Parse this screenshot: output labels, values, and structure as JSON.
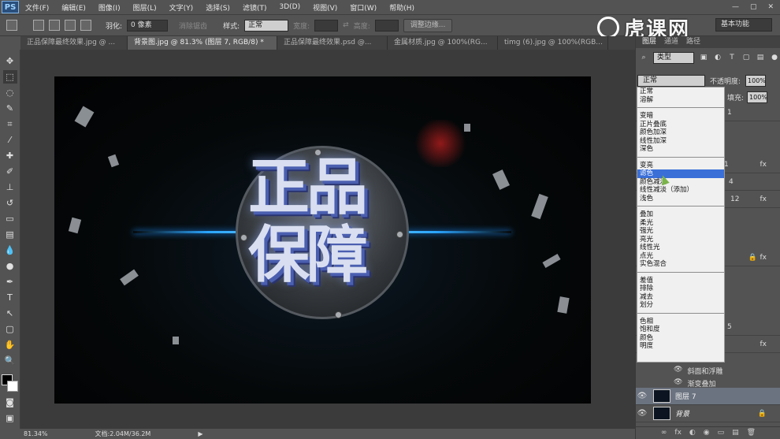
{
  "app": {
    "logo": "PS"
  },
  "menu": [
    "文件(F)",
    "编辑(E)",
    "图像(I)",
    "图层(L)",
    "文字(Y)",
    "选择(S)",
    "滤镜(T)",
    "3D(D)",
    "视图(V)",
    "窗口(W)",
    "帮助(H)"
  ],
  "window_controls": [
    "—",
    "▢",
    "✕"
  ],
  "options": {
    "feather_label": "羽化:",
    "feather_value": "0 像素",
    "antialias_label": "消除锯齿",
    "style_label": "样式:",
    "style_value": "正常",
    "width_label": "宽度:",
    "height_label": "高度:",
    "refine_button": "调整边缘...",
    "workspace": "基本功能"
  },
  "watermark": {
    "text": "虎课网"
  },
  "tabs": [
    "正品保障最终效果.jpg @ ...",
    "背景图.jpg @ 81.3% (图层 7, RGB/8) *",
    "正品保障最终效果.psd @...",
    "金属材质.jpg @ 100%(RG...",
    "timg (6).jpg @ 100%(RGB..."
  ],
  "tools": [
    "move-tool-icon",
    "marquee-tool-icon",
    "lasso-tool-icon",
    "quick-select-icon",
    "crop-tool-icon",
    "eyedropper-icon",
    "healing-brush-icon",
    "brush-tool-icon",
    "clone-stamp-icon",
    "history-brush-icon",
    "eraser-icon",
    "gradient-icon",
    "blur-icon",
    "dodge-icon",
    "pen-tool-icon",
    "type-tool-icon",
    "path-select-icon",
    "rectangle-tool-icon",
    "hand-tool-icon",
    "zoom-tool-icon"
  ],
  "tool_glyphs": [
    "✥",
    "⬚",
    "◌",
    "✎",
    "⌗",
    "⁄",
    "✚",
    "✐",
    "⊥",
    "↺",
    "▭",
    "▤",
    "💧",
    "●",
    "✒",
    "T",
    "↖",
    "▢",
    "✋",
    "🔍"
  ],
  "artwork": {
    "headline_line1": "正品",
    "headline_line2": "保障"
  },
  "status": {
    "zoom": "81.34%",
    "doc": "文档:2.04M/36.2M",
    "arrow": "▶"
  },
  "layers_panel": {
    "tabs": [
      "图层",
      "通道",
      "路径"
    ],
    "kind": "类型",
    "blend_mode": "正常",
    "opacity_label": "不透明度:",
    "opacity_value": "100%",
    "fill_label": "填充:",
    "fill_value": "100%",
    "partial_labels": [
      "1",
      "1",
      "4",
      "12",
      "5"
    ],
    "effects": [
      "斜面和浮雕",
      "渐变叠加"
    ],
    "layers": [
      {
        "name": "图层 7",
        "selected": true
      },
      {
        "name": "背景",
        "selected": false
      }
    ],
    "fx": "fx",
    "bottom_icons": [
      "∞",
      "fx",
      "◐",
      "◉",
      "▭",
      "▤",
      "🗑"
    ]
  },
  "blend_dropdown": {
    "groups": [
      [
        "正常",
        "溶解"
      ],
      [
        "变暗",
        "正片叠底",
        "颜色加深",
        "线性加深",
        "深色"
      ],
      [
        "变亮",
        "滤色",
        "颜色减淡",
        "线性减淡（添加）",
        "浅色"
      ],
      [
        "叠加",
        "柔光",
        "强光",
        "亮光",
        "线性光",
        "点光",
        "实色混合"
      ],
      [
        "差值",
        "排除",
        "减去",
        "划分"
      ],
      [
        "色相",
        "饱和度",
        "颜色",
        "明度"
      ]
    ],
    "highlighted": "滤色"
  }
}
